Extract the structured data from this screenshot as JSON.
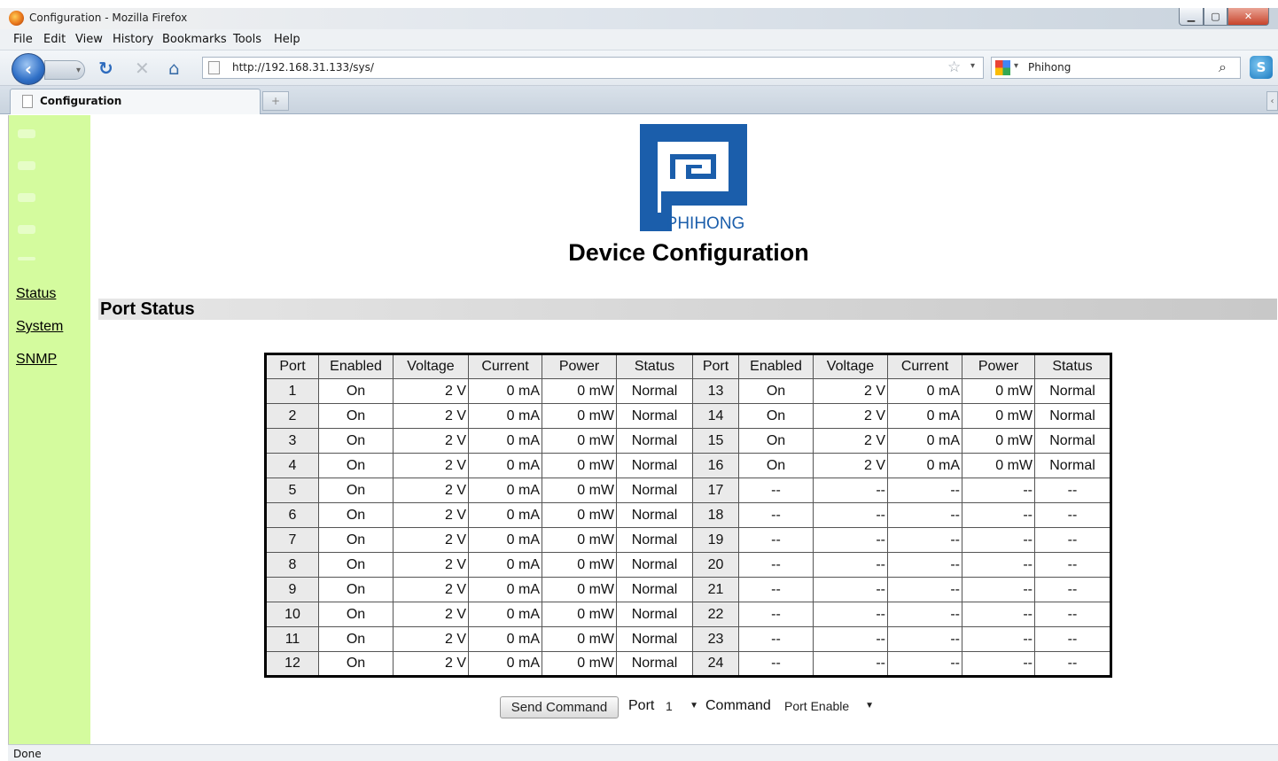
{
  "window": {
    "title": "Configuration - Mozilla Firefox"
  },
  "menu": [
    "File",
    "Edit",
    "View",
    "History",
    "Bookmarks",
    "Tools",
    "Help"
  ],
  "navbar": {
    "url": "http://192.168.31.133/sys/",
    "search_engine": "google-icon",
    "search_query": "Phihong"
  },
  "tab": {
    "label": "Configuration",
    "new_tab": "+"
  },
  "sidebar": {
    "links": [
      "Status",
      "System",
      "SNMP"
    ],
    "color": "#d4fb9e"
  },
  "brand": {
    "logo_text": "PHIHONG",
    "color": "#1b5eab"
  },
  "page": {
    "heading": "Device Configuration",
    "section_title": "Port Status"
  },
  "table": {
    "headers": [
      "Port",
      "Enabled",
      "Voltage",
      "Current",
      "Power",
      "Status",
      "Port",
      "Enabled",
      "Voltage",
      "Current",
      "Power",
      "Status"
    ],
    "rows": [
      [
        "1",
        "On",
        "2 V",
        "0 mA",
        "0 mW",
        "Normal",
        "13",
        "On",
        "2 V",
        "0 mA",
        "0 mW",
        "Normal"
      ],
      [
        "2",
        "On",
        "2 V",
        "0 mA",
        "0 mW",
        "Normal",
        "14",
        "On",
        "2 V",
        "0 mA",
        "0 mW",
        "Normal"
      ],
      [
        "3",
        "On",
        "2 V",
        "0 mA",
        "0 mW",
        "Normal",
        "15",
        "On",
        "2 V",
        "0 mA",
        "0 mW",
        "Normal"
      ],
      [
        "4",
        "On",
        "2 V",
        "0 mA",
        "0 mW",
        "Normal",
        "16",
        "On",
        "2 V",
        "0 mA",
        "0 mW",
        "Normal"
      ],
      [
        "5",
        "On",
        "2 V",
        "0 mA",
        "0 mW",
        "Normal",
        "17",
        "--",
        "--",
        "--",
        "--",
        "--"
      ],
      [
        "6",
        "On",
        "2 V",
        "0 mA",
        "0 mW",
        "Normal",
        "18",
        "--",
        "--",
        "--",
        "--",
        "--"
      ],
      [
        "7",
        "On",
        "2 V",
        "0 mA",
        "0 mW",
        "Normal",
        "19",
        "--",
        "--",
        "--",
        "--",
        "--"
      ],
      [
        "8",
        "On",
        "2 V",
        "0 mA",
        "0 mW",
        "Normal",
        "20",
        "--",
        "--",
        "--",
        "--",
        "--"
      ],
      [
        "9",
        "On",
        "2 V",
        "0 mA",
        "0 mW",
        "Normal",
        "21",
        "--",
        "--",
        "--",
        "--",
        "--"
      ],
      [
        "10",
        "On",
        "2 V",
        "0 mA",
        "0 mW",
        "Normal",
        "22",
        "--",
        "--",
        "--",
        "--",
        "--"
      ],
      [
        "11",
        "On",
        "2 V",
        "0 mA",
        "0 mW",
        "Normal",
        "23",
        "--",
        "--",
        "--",
        "--",
        "--"
      ],
      [
        "12",
        "On",
        "2 V",
        "0 mA",
        "0 mW",
        "Normal",
        "24",
        "--",
        "--",
        "--",
        "--",
        "--"
      ]
    ]
  },
  "form": {
    "send_label": "Send Command",
    "port_label": "Port",
    "port_value": "1",
    "command_label": "Command",
    "command_value": "Port Enable"
  },
  "status_bar": {
    "text": "Done"
  }
}
